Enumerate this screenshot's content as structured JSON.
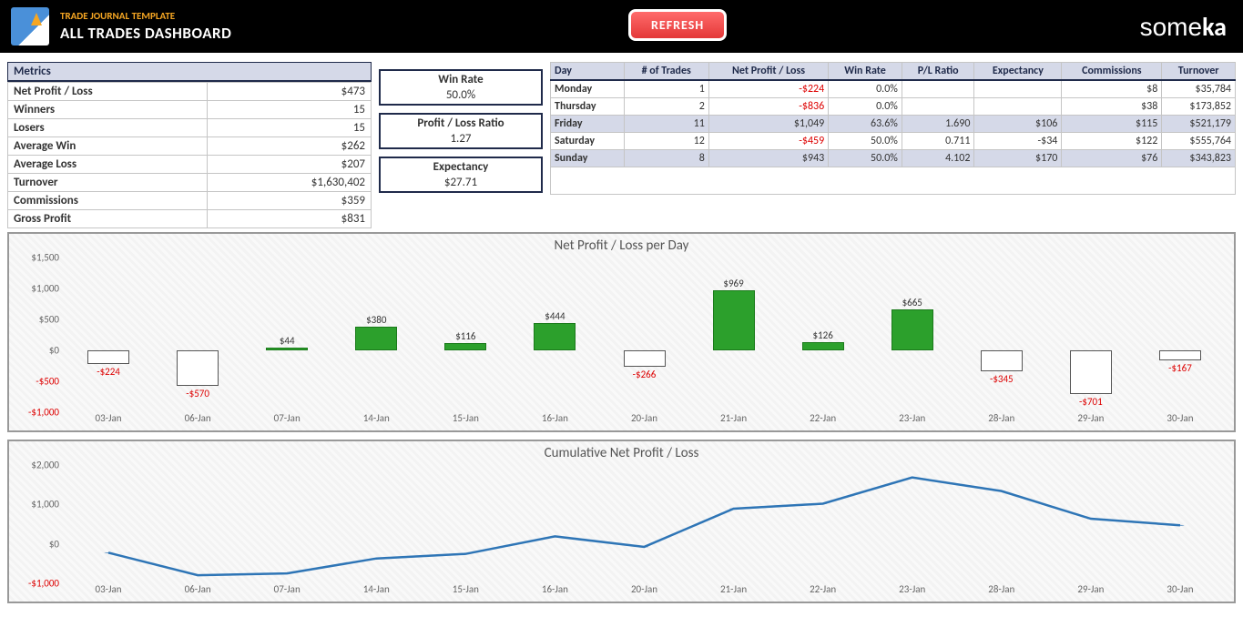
{
  "header": {
    "subtitle": "TRADE JOURNAL TEMPLATE",
    "title": "ALL TRADES DASHBOARD",
    "refresh": "REFRESH",
    "brand": "someka"
  },
  "metrics": {
    "header": "Metrics",
    "rows": [
      {
        "label": "Net Profit / Loss",
        "value": "$473"
      },
      {
        "label": "Winners",
        "value": "15"
      },
      {
        "label": "Losers",
        "value": "15"
      },
      {
        "label": "Average Win",
        "value": "$262"
      },
      {
        "label": "Average Loss",
        "value": "$207"
      },
      {
        "label": "Turnover",
        "value": "$1,630,402"
      },
      {
        "label": "Commissions",
        "value": "$359"
      },
      {
        "label": "Gross Profit",
        "value": "$831"
      }
    ]
  },
  "kpis": [
    {
      "label": "Win Rate",
      "value": "50.0%"
    },
    {
      "label": "Profit / Loss Ratio",
      "value": "1.27"
    },
    {
      "label": "Expectancy",
      "value": "$27.71"
    }
  ],
  "daytable": {
    "headers": [
      "Day",
      "# of Trades",
      "Net Profit / Loss",
      "Win Rate",
      "P/L Ratio",
      "Expectancy",
      "Commissions",
      "Turnover"
    ],
    "rows": [
      {
        "cls": "",
        "cells": [
          "Monday",
          "1",
          "-$224",
          "0.0%",
          "",
          "",
          "$8",
          "$35,784"
        ],
        "negidx": [
          2
        ]
      },
      {
        "cls": "",
        "cells": [
          "Thursday",
          "2",
          "-$836",
          "0.0%",
          "",
          "",
          "$38",
          "$173,852"
        ],
        "negidx": [
          2
        ]
      },
      {
        "cls": "fri",
        "cells": [
          "Friday",
          "11",
          "$1,049",
          "63.6%",
          "1.690",
          "$106",
          "$115",
          "$521,179"
        ],
        "negidx": []
      },
      {
        "cls": "",
        "cells": [
          "Saturday",
          "12",
          "-$459",
          "50.0%",
          "0.711",
          "-$34",
          "$122",
          "$555,764"
        ],
        "negidx": [
          2
        ]
      },
      {
        "cls": "sun",
        "cells": [
          "Sunday",
          "8",
          "$943",
          "50.0%",
          "4.102",
          "$170",
          "$76",
          "$343,823"
        ],
        "negidx": []
      }
    ]
  },
  "chart_data": [
    {
      "type": "bar",
      "title": "Net Profit / Loss per Day",
      "categories": [
        "03-Jan",
        "06-Jan",
        "07-Jan",
        "14-Jan",
        "15-Jan",
        "16-Jan",
        "20-Jan",
        "21-Jan",
        "22-Jan",
        "23-Jan",
        "28-Jan",
        "29-Jan",
        "30-Jan"
      ],
      "values": [
        -224,
        -570,
        44,
        380,
        116,
        444,
        -266,
        969,
        126,
        665,
        -345,
        -701,
        -167
      ],
      "ylim": [
        -1000,
        1500
      ],
      "yticks": [
        -1000,
        -500,
        0,
        500,
        1000,
        1500
      ],
      "ylabels": [
        "-$1,000",
        "-$500",
        "$0",
        "$500",
        "$1,000",
        "$1,500"
      ],
      "datalabels": [
        "-$224",
        "-$570",
        "$44",
        "$380",
        "$116",
        "$444",
        "-$266",
        "$969",
        "$126",
        "$665",
        "-$345",
        "-$701",
        "-$167"
      ]
    },
    {
      "type": "line",
      "title": "Cumulative Net Profit / Loss",
      "categories": [
        "03-Jan",
        "06-Jan",
        "07-Jan",
        "14-Jan",
        "15-Jan",
        "16-Jan",
        "20-Jan",
        "21-Jan",
        "22-Jan",
        "23-Jan",
        "28-Jan",
        "29-Jan",
        "30-Jan"
      ],
      "values": [
        -224,
        -794,
        -750,
        -370,
        -254,
        190,
        -76,
        893,
        1019,
        1684,
        1339,
        638,
        471
      ],
      "ylim": [
        -1000,
        2000
      ],
      "yticks": [
        -1000,
        0,
        1000,
        2000
      ],
      "ylabels": [
        "-$1,000",
        "$0",
        "$1,000",
        "$2,000"
      ]
    }
  ]
}
